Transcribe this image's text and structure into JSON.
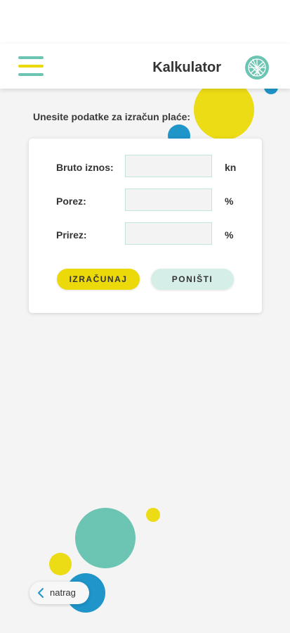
{
  "header": {
    "title": "Kalkulator"
  },
  "form": {
    "prompt": "Unesite podatke za izračun plaće:",
    "fields": [
      {
        "label": "Bruto iznos:",
        "value": "",
        "unit": "kn"
      },
      {
        "label": "Porez:",
        "value": "",
        "unit": "%"
      },
      {
        "label": "Prirez:",
        "value": "",
        "unit": "%"
      }
    ],
    "calculate_label": "IZRAČUNAJ",
    "reset_label": "PONIŠTI"
  },
  "footer": {
    "back_label": "natrag"
  },
  "colors": {
    "yellow": "#ecd90a",
    "teal": "#6cc4b2",
    "blue": "#1f95c9",
    "mint": "#d6eee8"
  },
  "icons": {
    "menu": "hamburger-menu-icon",
    "logo": "globe-network-logo",
    "back": "chevron-left-icon"
  }
}
